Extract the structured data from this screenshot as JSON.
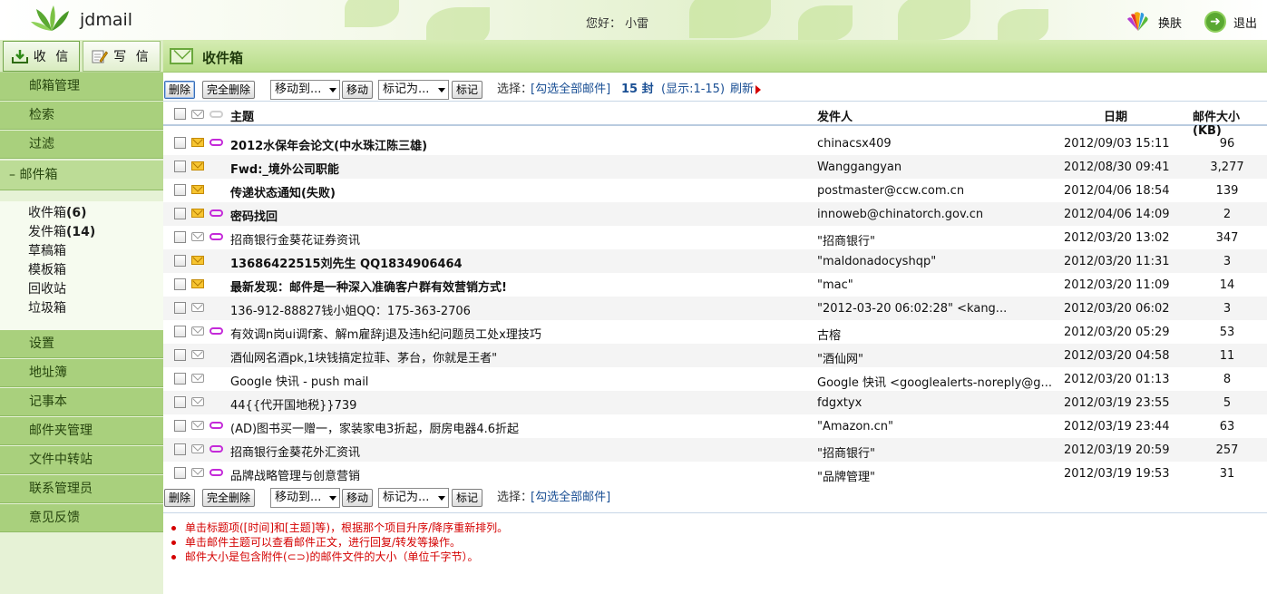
{
  "header": {
    "logo_text": "jdmail",
    "greeting": "您好：",
    "username": "小雷",
    "skin_label": "换肤",
    "logout_label": "退出"
  },
  "sidebar": {
    "receive_label": "收 信",
    "write_label": "写 信",
    "nav_top": [
      {
        "label": "邮箱管理"
      },
      {
        "label": "检索"
      },
      {
        "label": "过滤"
      }
    ],
    "mailbox_label": "–  邮件箱",
    "folders": [
      {
        "label": "收件箱",
        "count": "(6)"
      },
      {
        "label": "发件箱",
        "count": "(14)"
      },
      {
        "label": "草稿箱",
        "count": ""
      },
      {
        "label": "模板箱",
        "count": ""
      },
      {
        "label": "回收站",
        "count": ""
      },
      {
        "label": "垃圾箱",
        "count": ""
      }
    ],
    "nav_bottom": [
      {
        "label": "设置"
      },
      {
        "label": "地址簿"
      },
      {
        "label": "记事本"
      },
      {
        "label": "邮件夹管理"
      },
      {
        "label": "文件中转站"
      },
      {
        "label": "联系管理员"
      },
      {
        "label": "意见反馈"
      }
    ]
  },
  "main": {
    "title": "收件箱",
    "toolbar": {
      "delete": "删除",
      "perm_delete": "完全删除",
      "move_to": "移动到...",
      "move": "移动",
      "mark_as": "标记为...",
      "mark": "标记",
      "select_label": "选择：",
      "select_all": "[勾选全部邮件]",
      "count_text": "15 封",
      "display_text": "(显示:1-15)",
      "refresh": "刷新"
    },
    "columns": {
      "subject": "主题",
      "sender": "发件人",
      "date": "日期",
      "size": "邮件大小(KB)"
    },
    "emails": [
      {
        "subject": "2012水保年会论文(中水珠江陈三雄)",
        "sender": "chinacsx409",
        "date": "2012/09/03 15:11",
        "size": "96",
        "unread": true,
        "attach": true
      },
      {
        "subject": "Fwd:_境外公司职能",
        "sender": "Wanggangyan",
        "date": "2012/08/30 09:41",
        "size": "3,277",
        "unread": true,
        "attach": false
      },
      {
        "subject": "传递状态通知(失败)",
        "sender": "postmaster@ccw.com.cn",
        "date": "2012/04/06 18:54",
        "size": "139",
        "unread": true,
        "attach": false
      },
      {
        "subject": "密码找回",
        "sender": "innoweb@chinatorch.gov.cn",
        "date": "2012/04/06 14:09",
        "size": "2",
        "unread": true,
        "attach": true
      },
      {
        "subject": "招商银行金葵花证券资讯",
        "sender": "\"招商银行\"",
        "date": "2012/03/20 13:02",
        "size": "347",
        "unread": false,
        "attach": true
      },
      {
        "subject": "13686422515刘先生  QQ1834906464",
        "sender": "\"maldonadocyshqp\"",
        "date": "2012/03/20 11:31",
        "size": "3",
        "unread": true,
        "attach": false
      },
      {
        "subject": "最新发现：邮件是一种深入准确客户群有效营销方式!",
        "sender": "\"mac\"",
        "date": "2012/03/20 11:09",
        "size": "14",
        "unread": true,
        "attach": false
      },
      {
        "subject": "136-912-88827钱小姐QQ：175-363-2706",
        "sender": "\"2012-03-20 06:02:28\" <kang...",
        "date": "2012/03/20 06:02",
        "size": "3",
        "unread": false,
        "attach": false
      },
      {
        "subject": "有效调n岗ui调f紊、解m雇辞j退及违h纪问题员工处x理技巧",
        "sender": "古榕",
        "date": "2012/03/20 05:29",
        "size": "53",
        "unread": false,
        "attach": true
      },
      {
        "subject": "酒仙网名酒pk,1块钱搞定拉菲、茅台，你就是王者\"",
        "sender": "\"酒仙网\"",
        "date": "2012/03/20 04:58",
        "size": "11",
        "unread": false,
        "attach": false
      },
      {
        "subject": "Google 快讯 - push mail",
        "sender": "Google 快讯 <googlealerts-noreply@g...",
        "date": "2012/03/20 01:13",
        "size": "8",
        "unread": false,
        "attach": false
      },
      {
        "subject": "44{{代开国地税}}739",
        "sender": "fdgxtyx",
        "date": "2012/03/19 23:55",
        "size": "5",
        "unread": false,
        "attach": false
      },
      {
        "subject": "(AD)图书买一赠一，家装家电3折起，厨房电器4.6折起",
        "sender": "\"Amazon.cn\"",
        "date": "2012/03/19 23:44",
        "size": "63",
        "unread": false,
        "attach": true
      },
      {
        "subject": "招商银行金葵花外汇资讯",
        "sender": "\"招商银行\"",
        "date": "2012/03/19 20:59",
        "size": "257",
        "unread": false,
        "attach": true
      },
      {
        "subject": "品牌战略管理与创意营销",
        "sender": "\"品牌管理\"",
        "date": "2012/03/19 19:53",
        "size": "31",
        "unread": false,
        "attach": true
      }
    ],
    "notes": [
      "单击标题项([时间]和[主题]等)，根据那个项目升序/降序重新排列。",
      "单击邮件主题可以查看邮件正文，进行回复/转发等操作。",
      "邮件大小是包含附件(⊂⊃)的邮件文件的大小（单位千字节）。"
    ]
  },
  "colors": {
    "nav_green": "#a9d07d",
    "title_green": "#b7dc88",
    "link_blue": "#1a4f94",
    "note_red": "#d40000"
  }
}
